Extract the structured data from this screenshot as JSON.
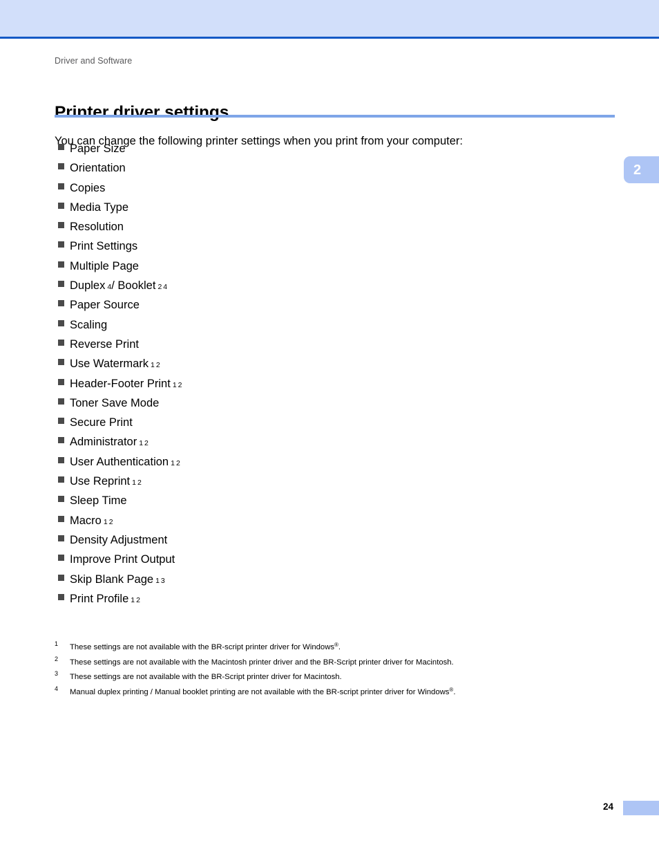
{
  "page": {
    "running_header": "Driver and Software",
    "chapter_number": "2",
    "page_number": "24",
    "accent_band_color": "#d2dffa",
    "accent_rule_color": "#1559c6",
    "heading_rule_color": "#7ea5e8",
    "tab_color": "#aec5f5"
  },
  "section": {
    "title": "Printer driver settings",
    "intro": "You can change the following printer settings when you print from your computer:"
  },
  "settings": [
    {
      "label": "Paper Size",
      "notes": []
    },
    {
      "label": "Orientation",
      "notes": []
    },
    {
      "label": "Copies",
      "notes": []
    },
    {
      "label": "Media Type",
      "notes": []
    },
    {
      "label": "Resolution",
      "notes": []
    },
    {
      "label": "Print Settings",
      "notes": []
    },
    {
      "label": "Multiple Page",
      "notes": []
    },
    {
      "label": "Duplex",
      "notes": [
        "4"
      ],
      "label2": "/ Booklet",
      "notes2": [
        "2",
        "4"
      ]
    },
    {
      "label": "Paper Source",
      "notes": []
    },
    {
      "label": "Scaling",
      "notes": []
    },
    {
      "label": "Reverse Print",
      "notes": []
    },
    {
      "label": "Use Watermark",
      "notes": [
        "1",
        "2"
      ]
    },
    {
      "label": "Header-Footer Print",
      "notes": [
        "1",
        "2"
      ]
    },
    {
      "label": "Toner Save Mode",
      "notes": []
    },
    {
      "label": "Secure Print",
      "notes": []
    },
    {
      "label": "Administrator",
      "notes": [
        "1",
        "2"
      ]
    },
    {
      "label": "User Authentication",
      "notes": [
        "1",
        "2"
      ]
    },
    {
      "label": "Use Reprint",
      "notes": [
        "1",
        "2"
      ]
    },
    {
      "label": "Sleep Time",
      "notes": []
    },
    {
      "label": "Macro",
      "notes": [
        "1",
        "2"
      ]
    },
    {
      "label": "Density Adjustment",
      "notes": []
    },
    {
      "label": "Improve Print Output",
      "notes": []
    },
    {
      "label": "Skip Blank Page",
      "notes": [
        "1",
        "3"
      ]
    },
    {
      "label": "Print Profile",
      "notes": [
        "1",
        "2"
      ]
    }
  ],
  "footnotes": [
    {
      "marker": "1",
      "text_before": "These settings are not available with the BR-script printer driver for Windows",
      "sup": "®",
      "text_after": "."
    },
    {
      "marker": "2",
      "text_before": "These settings are not available with the Macintosh printer driver and the BR-Script printer driver for Macintosh.",
      "sup": "",
      "text_after": ""
    },
    {
      "marker": "3",
      "text_before": "These settings are not available with the BR-Script printer driver for Macintosh.",
      "sup": "",
      "text_after": ""
    },
    {
      "marker": "4",
      "text_before": "Manual duplex printing / Manual booklet printing are not available with the BR-script printer driver for Windows",
      "sup": "®",
      "text_after": "."
    }
  ]
}
